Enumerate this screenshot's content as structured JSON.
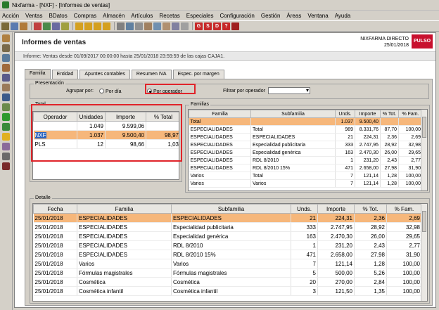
{
  "window": {
    "title": "Nixfarma - [NXF] - [Informes de ventas]"
  },
  "menu": [
    "Acción",
    "Ventas",
    "BDatos",
    "Compras",
    "Almacén",
    "Artículos",
    "Recetas",
    "Especiales",
    "Configuración",
    "Gestión",
    "Áreas",
    "Ventana",
    "Ayuda"
  ],
  "header": {
    "title": "Informes de ventas",
    "company": "NIXFARMA DIRECTO",
    "date": "25/01/2018",
    "logo": "PULSO",
    "info": "Informe:  Ventas desde 01/09/2017 00:00:00 hasta 25/01/2018 23:59:59 de las cajas CAJA1."
  },
  "tabs": [
    "Familia",
    "Entidad",
    "Apuntes contables",
    "Resumen IVA",
    "Espec. por margen"
  ],
  "presentacion": {
    "group_label": "Presentación",
    "agrupar_label": "Agrupar por:",
    "opt_dia": "Por día",
    "opt_operador": "Por operador",
    "filtrar_label": "Filtrar por operador"
  },
  "total": {
    "group_label": "Total",
    "columns": [
      "Operador",
      "Unidades",
      "Importe",
      "% Total"
    ],
    "rows": [
      [
        "",
        "1.049",
        "9.599,06",
        ""
      ],
      [
        "NXF",
        "1.037",
        "9.500,40",
        "98,97"
      ],
      [
        "PLS",
        "12",
        "98,66",
        "1,03"
      ]
    ]
  },
  "familias": {
    "group_label": "Familias",
    "columns": [
      "Familia",
      "Subfamilia",
      "Unds.",
      "Importe",
      "% Tot.",
      "% Fam."
    ],
    "rows": [
      [
        "Total",
        "",
        "1.037",
        "9.500,40",
        "",
        ""
      ],
      [
        "ESPECIALIDADES",
        "Total",
        "989",
        "8.331,76",
        "87,70",
        "100,00"
      ],
      [
        "ESPECIALIDADES",
        "ESPECIALIDADES",
        "21",
        "224,31",
        "2,36",
        "2,69"
      ],
      [
        "ESPECIALIDADES",
        "Especialidad publicitaria",
        "333",
        "2.747,95",
        "28,92",
        "32,98"
      ],
      [
        "ESPECIALIDADES",
        "Especialidad genérica",
        "163",
        "2.470,30",
        "26,00",
        "29,65"
      ],
      [
        "ESPECIALIDADES",
        "RDL 8/2010",
        "1",
        "231,20",
        "2,43",
        "2,77"
      ],
      [
        "ESPECIALIDADES",
        "RDL 8/2010 15%",
        "471",
        "2.658,00",
        "27,98",
        "31,90"
      ],
      [
        "Varios",
        "Total",
        "7",
        "121,14",
        "1,28",
        "100,00"
      ],
      [
        "Varios",
        "Varios",
        "7",
        "121,14",
        "1,28",
        "100,00"
      ]
    ]
  },
  "detalle": {
    "group_label": "Detalle",
    "columns": [
      "Fecha",
      "Familia",
      "Subfamilia",
      "Unds.",
      "Importe",
      "% Tot.",
      "% Fam."
    ],
    "rows": [
      [
        "25/01/2018",
        "ESPECIALIDADES",
        "ESPECIALIDADES",
        "21",
        "224,31",
        "2,36",
        "2,69"
      ],
      [
        "25/01/2018",
        "ESPECIALIDADES",
        "Especialidad publicitaria",
        "333",
        "2.747,95",
        "28,92",
        "32,98"
      ],
      [
        "25/01/2018",
        "ESPECIALIDADES",
        "Especialidad genérica",
        "163",
        "2.470,30",
        "26,00",
        "29,65"
      ],
      [
        "25/01/2018",
        "ESPECIALIDADES",
        "RDL 8/2010",
        "1",
        "231,20",
        "2,43",
        "2,77"
      ],
      [
        "25/01/2018",
        "ESPECIALIDADES",
        "RDL 8/2010 15%",
        "471",
        "2.658,00",
        "27,98",
        "31,90"
      ],
      [
        "25/01/2018",
        "Varios",
        "Varios",
        "7",
        "121,14",
        "1,28",
        "100,00"
      ],
      [
        "25/01/2018",
        "Fórmulas magistrales",
        "Fórmulas magistrales",
        "5",
        "500,00",
        "5,26",
        "100,00"
      ],
      [
        "25/01/2018",
        "Cosmética",
        "Cosmética",
        "20",
        "270,00",
        "2,84",
        "100,00"
      ],
      [
        "25/01/2018",
        "Cosmética infantil",
        "Cosmética infantil",
        "3",
        "121,50",
        "1,35",
        "100,00"
      ]
    ]
  }
}
